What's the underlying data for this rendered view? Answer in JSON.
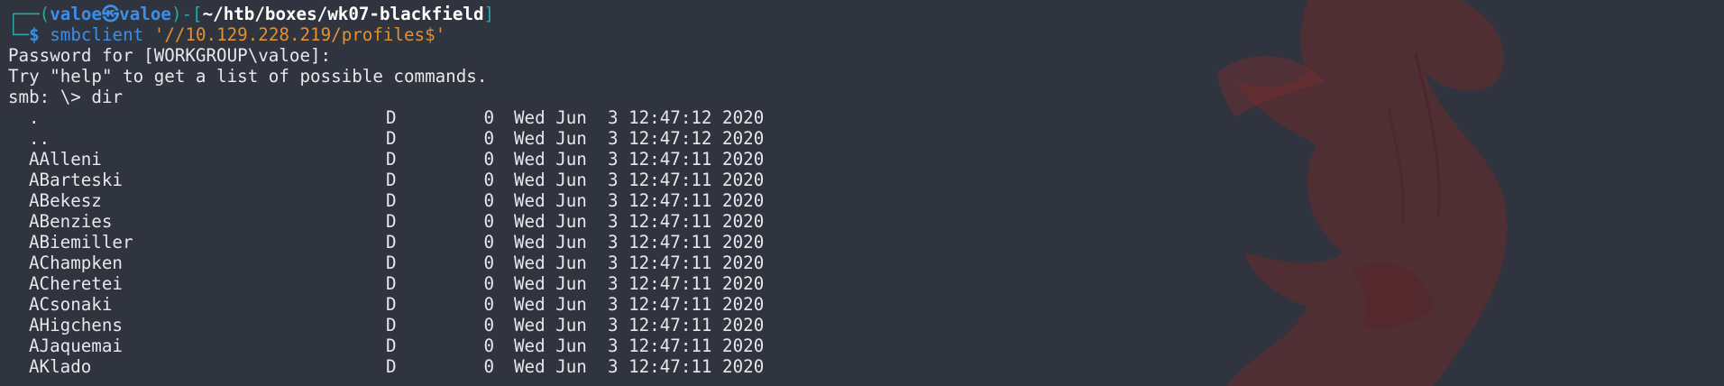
{
  "prompt": {
    "user": "valoe",
    "at_symbol": "㉿",
    "host": "valoe",
    "path": "~/htb/boxes/wk07-blackfield",
    "dollar": "$",
    "command": "smbclient",
    "argument": "'//10.129.228.219/profiles$'"
  },
  "output": {
    "password_prompt": "Password for [WORKGROUP\\valoe]:",
    "help_hint": "Try \"help\" to get a list of possible commands.",
    "smb_prompt": "smb: \\> ",
    "smb_command": "dir"
  },
  "listing": [
    {
      "name": ".",
      "attr": "D",
      "size": "0",
      "date": "Wed Jun  3 12:47:12 2020"
    },
    {
      "name": "..",
      "attr": "D",
      "size": "0",
      "date": "Wed Jun  3 12:47:12 2020"
    },
    {
      "name": "AAlleni",
      "attr": "D",
      "size": "0",
      "date": "Wed Jun  3 12:47:11 2020"
    },
    {
      "name": "ABarteski",
      "attr": "D",
      "size": "0",
      "date": "Wed Jun  3 12:47:11 2020"
    },
    {
      "name": "ABekesz",
      "attr": "D",
      "size": "0",
      "date": "Wed Jun  3 12:47:11 2020"
    },
    {
      "name": "ABenzies",
      "attr": "D",
      "size": "0",
      "date": "Wed Jun  3 12:47:11 2020"
    },
    {
      "name": "ABiemiller",
      "attr": "D",
      "size": "0",
      "date": "Wed Jun  3 12:47:11 2020"
    },
    {
      "name": "AChampken",
      "attr": "D",
      "size": "0",
      "date": "Wed Jun  3 12:47:11 2020"
    },
    {
      "name": "ACheretei",
      "attr": "D",
      "size": "0",
      "date": "Wed Jun  3 12:47:11 2020"
    },
    {
      "name": "ACsonaki",
      "attr": "D",
      "size": "0",
      "date": "Wed Jun  3 12:47:11 2020"
    },
    {
      "name": "AHigchens",
      "attr": "D",
      "size": "0",
      "date": "Wed Jun  3 12:47:11 2020"
    },
    {
      "name": "AJaquemai",
      "attr": "D",
      "size": "0",
      "date": "Wed Jun  3 12:47:11 2020"
    },
    {
      "name": "AKlado",
      "attr": "D",
      "size": "0",
      "date": "Wed Jun  3 12:47:11 2020"
    }
  ],
  "colors": {
    "background": "#2f343f",
    "prompt_frame": "#2aa7a7",
    "prompt_user": "#3b8eea",
    "command": "#3b8eea",
    "argument": "#e58f2f",
    "text": "#e6e8ea",
    "wallpaper_accent": "#6a2a2c"
  },
  "icons": {
    "wallpaper": "dragon-logo-icon"
  }
}
